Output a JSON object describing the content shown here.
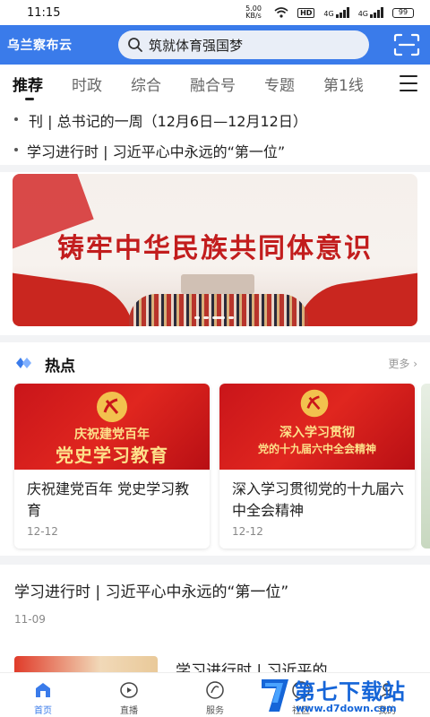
{
  "status_bar": {
    "time": "11:15",
    "net_speed": "5.00 KB/s",
    "hd": "HD",
    "signal1": "4G",
    "signal2": "4G",
    "battery": "99"
  },
  "header": {
    "logo": "乌兰察布云",
    "search_text": "筑就体育强国梦"
  },
  "tabs": [
    "推荐",
    "时政",
    "综合",
    "融合号",
    "专题",
    "第1线"
  ],
  "ticker": [
    "刊 | 总书记的一周（12月6日—12月12日）",
    "学习进行时 | 习近平心中永远的“第一位”"
  ],
  "banner": {
    "headline": "铸牢中华民族共同体意识"
  },
  "hot": {
    "title": "热点",
    "more": "更多 ›",
    "cards": [
      {
        "img_line1": "庆祝建党百年",
        "img_line2": "党史学习教育",
        "title": "庆祝建党百年 党史学习教育",
        "date": "12-12"
      },
      {
        "img_line1": "深入学习贯彻",
        "img_line2": "党的十九届六中全会精神",
        "title": "深入学习贯彻党的十九届六中全会精神",
        "date": "12-12"
      }
    ]
  },
  "news": [
    {
      "title": "学习进行时 | 习近平心中永远的“第一位”",
      "date": "11-09"
    },
    {
      "title": "学习进行时 | 习近平的"
    }
  ],
  "bottom_nav": [
    {
      "label": "首页",
      "icon": "home-icon"
    },
    {
      "label": "直播",
      "icon": "live-icon"
    },
    {
      "label": "服务",
      "icon": "service-icon"
    },
    {
      "label": "社区",
      "icon": "community-icon"
    },
    {
      "label": "我的",
      "icon": "profile-icon"
    }
  ],
  "watermark": {
    "brand": "第七下载站",
    "url": "www.d7down.com"
  },
  "colors": {
    "brand_blue": "#3a7bea",
    "party_red": "#c9151a",
    "gold": "#fde08a"
  }
}
